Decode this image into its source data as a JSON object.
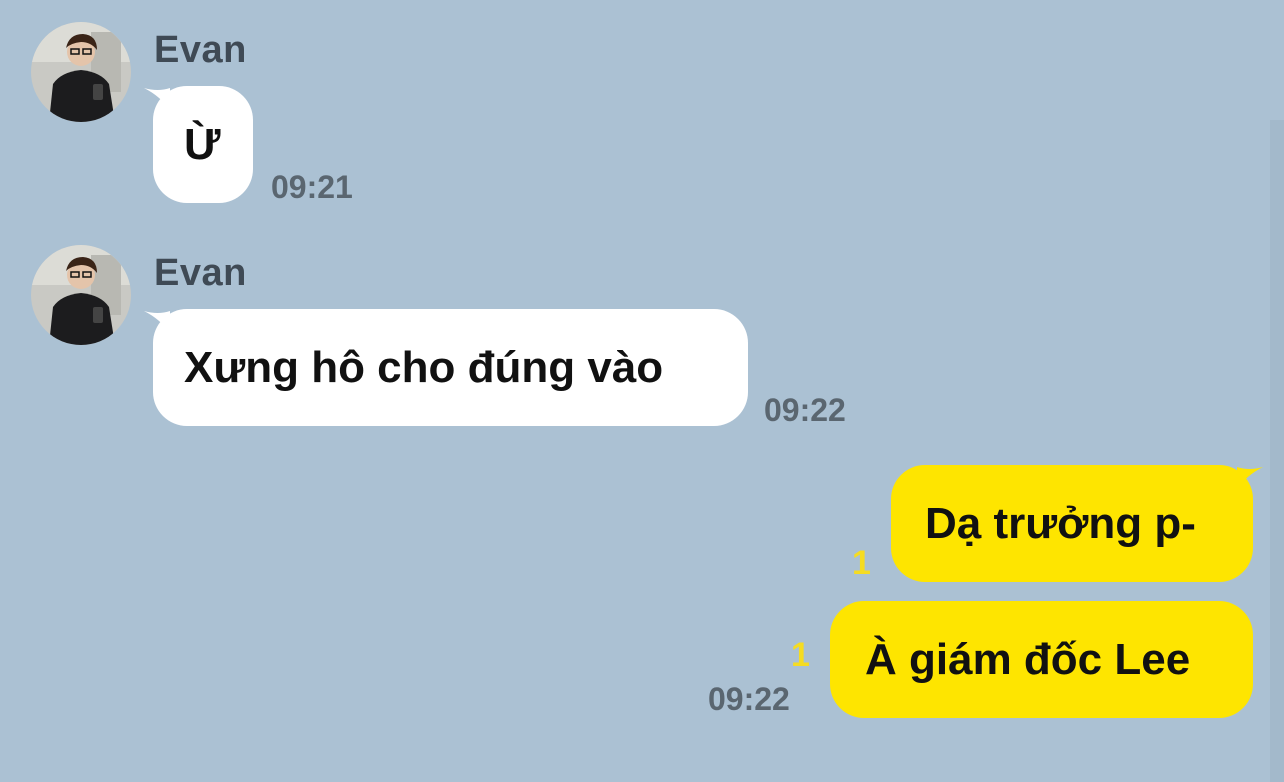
{
  "colors": {
    "background": "#abc1d3",
    "incoming_bubble": "#ffffff",
    "outgoing_bubble": "#fee500",
    "unread_count": "#f5dc22",
    "timestamp": "#5a6670"
  },
  "messages": [
    {
      "direction": "incoming",
      "sender": "Evan",
      "avatar_icon": "profile-photo",
      "text": "Ừ",
      "time": "09:21"
    },
    {
      "direction": "incoming",
      "sender": "Evan",
      "avatar_icon": "profile-photo",
      "text": "Xưng hô cho đúng vào",
      "time": "09:22"
    },
    {
      "direction": "outgoing",
      "text": "Dạ trưởng p-",
      "unread": "1"
    },
    {
      "direction": "outgoing",
      "text": "À giám đốc Lee",
      "unread": "1",
      "time": "09:22"
    }
  ]
}
